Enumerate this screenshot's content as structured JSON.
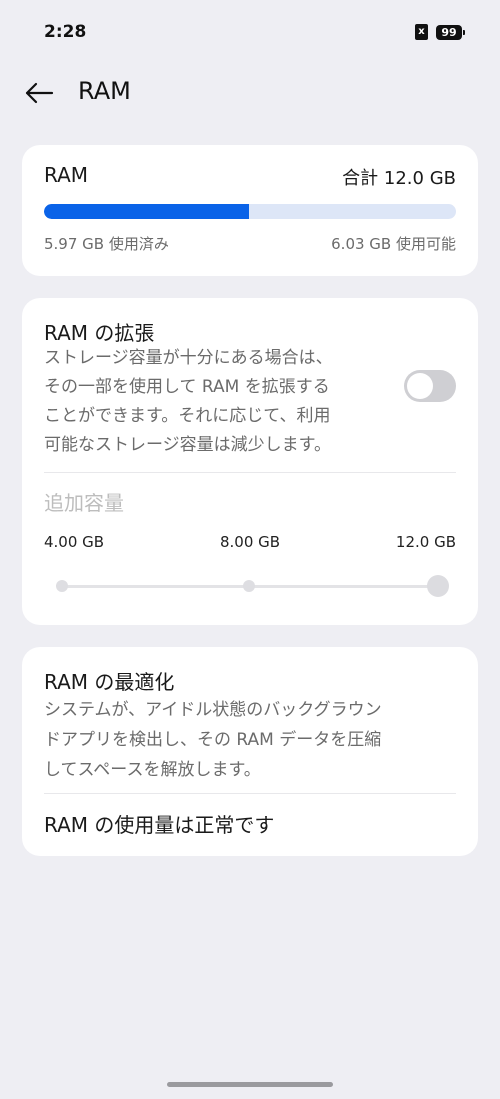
{
  "status_bar": {
    "time": "2:28",
    "sim_icon": "x",
    "battery": "99"
  },
  "header": {
    "back_icon": "arrow-left-icon",
    "title": "RAM"
  },
  "ram_card": {
    "title": "RAM",
    "total": "合計 12.0 GB",
    "used": "5.97 GB 使用済み",
    "available": "6.03 GB 使用可能",
    "used_fraction": 0.4975,
    "colors": {
      "used": "#0a63e8",
      "track": "#dde6f7"
    }
  },
  "expand_card": {
    "title": "RAM の拡張",
    "description_lines": [
      "ストレージ容量が十分にある場合は、",
      "その一部を使用して RAM を拡張する",
      "ことができます。それに応じて、利用",
      "可能なストレージ容量は減少します。"
    ],
    "toggle_on": false,
    "added_capacity_label": "追加容量",
    "ticks": [
      "4.00 GB",
      "8.00 GB",
      "12.0 GB"
    ],
    "selected_tick": "12.0 GB"
  },
  "optimize_card": {
    "title": "RAM の最適化",
    "description_lines": [
      "システムが、アイドル状態のバックグラウン",
      "ドアプリを検出し、その RAM データを圧縮",
      "してスペースを解放します。"
    ],
    "status": "RAM の使用量は正常です"
  }
}
